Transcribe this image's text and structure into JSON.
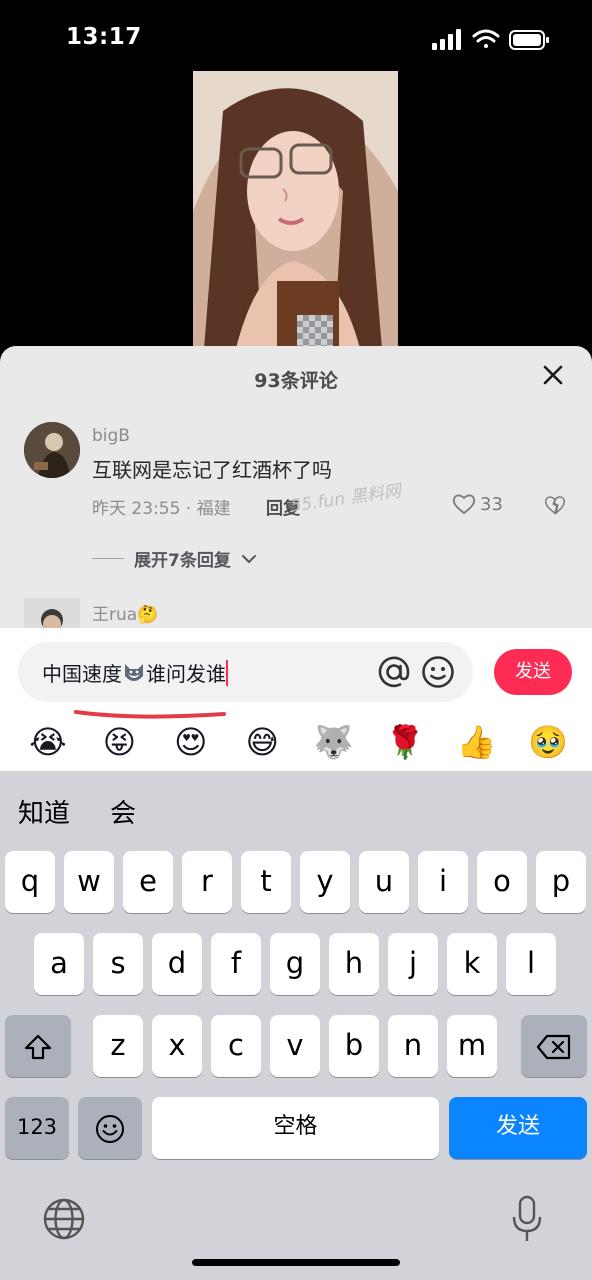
{
  "status": {
    "time": "13:17"
  },
  "comments_sheet": {
    "title": "93条评论",
    "comments": [
      {
        "user": "bigB",
        "text": "互联网是忘记了红酒杯了吗",
        "meta": "昨天 23:55 · 福建",
        "reply_label": "回复",
        "likes": "33"
      },
      {
        "user": "王rua🤔"
      }
    ],
    "expand_label": "展开7条回复",
    "watermark": "55.fun 黑料网"
  },
  "composer": {
    "input_value_before": "中国速度",
    "input_value_after": "谁问发谁",
    "send_label": "发送",
    "quick_emojis": [
      "😭",
      "😝",
      "😍",
      "😅",
      "🐺",
      "🌹",
      "👍",
      "🥹"
    ]
  },
  "keyboard": {
    "candidates": [
      "知道",
      "会"
    ],
    "row1": [
      "q",
      "w",
      "e",
      "r",
      "t",
      "y",
      "u",
      "i",
      "o",
      "p"
    ],
    "row2": [
      "a",
      "s",
      "d",
      "f",
      "g",
      "h",
      "j",
      "k",
      "l"
    ],
    "row3": [
      "z",
      "x",
      "c",
      "v",
      "b",
      "n",
      "m"
    ],
    "num_label": "123",
    "space_label": "空格",
    "send_label": "发送"
  },
  "colors": {
    "accent": "#fe2c55",
    "keyboard_send": "#0a84ff"
  }
}
